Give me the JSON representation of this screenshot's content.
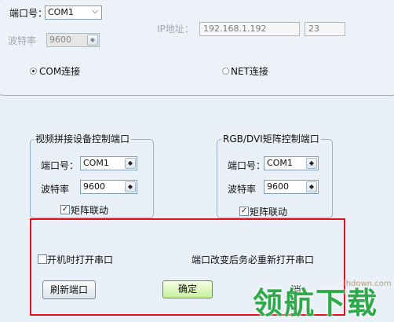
{
  "top": {
    "port_label": "端口号：",
    "port_value": "COM1",
    "baud_label": "波特率",
    "baud_value": "9600",
    "ip_label": "IP地址：",
    "ip_value": "192.168.1.192",
    "ip_port_value": "23",
    "com_radio_label": "COM连接",
    "net_radio_label": "NET连接"
  },
  "video_group": {
    "title": "视频拼接设备控制端口",
    "port_label": "端口号：",
    "port_value": "COM1",
    "baud_label": "波特率",
    "baud_value": "9600",
    "matrix_link_label": "矩阵联动",
    "matrix_link_checked": true
  },
  "rgb_group": {
    "title": "RGB/DVI矩阵控制端口",
    "port_label": "端口号：",
    "port_value": "COM1",
    "baud_label": "波特率",
    "baud_value": "9600",
    "matrix_link_label": "矩阵联动",
    "matrix_link_checked": true
  },
  "bottom": {
    "open_on_boot_label": "开机时打开串口",
    "open_on_boot_checked": false,
    "notice": "端口改变后务必重新打开串口",
    "refresh_button": "刷新端口",
    "ok_button": "确定",
    "cancel_fragment": "消"
  },
  "watermark": {
    "url": "lhdown.com",
    "text": "领航下载"
  },
  "colors": {
    "highlight_box": "#e0121b",
    "ok_button": "#c9f09a",
    "watermark_green": "#2faa4a"
  }
}
